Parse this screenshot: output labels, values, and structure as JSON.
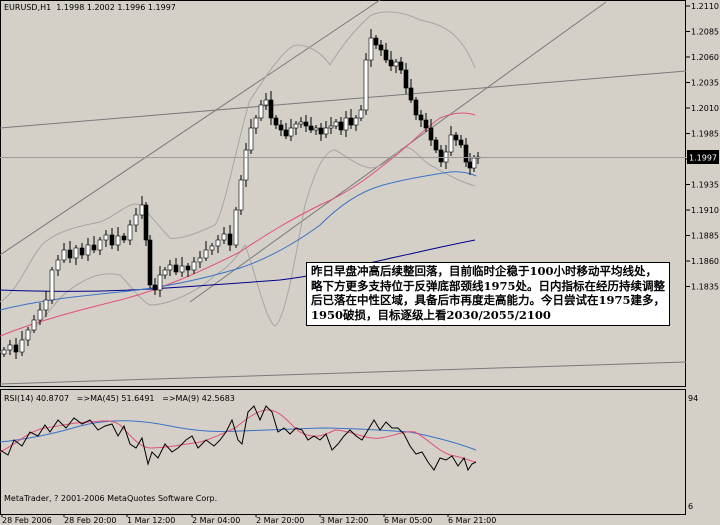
{
  "chart": {
    "symbol_header": "EURUSD,H1  1.1998 1.2002 1.1996 1.1997",
    "last_price": "1.1997",
    "price_ticks": [
      "1.2110",
      "1.2085",
      "1.2060",
      "1.2035",
      "1.2010",
      "1.1985",
      "1.1960",
      "1.1935",
      "1.1910",
      "1.1885",
      "1.1860",
      "1.1835"
    ],
    "time_ticks": [
      "28 Feb 2006",
      "28 Feb 20:00",
      "1 Mar 12:00",
      "2 Mar 04:00",
      "2 Mar 20:00",
      "3 Mar 12:00",
      "6 Mar 05:00",
      "6 Mar 21:00"
    ],
    "colors": {
      "bull": "#ffffff",
      "bear": "#000000",
      "ma_red": "#e0507a",
      "ma_blue": "#3a72c8",
      "ma_navy": "#00008b",
      "bands": "#a9a9a9"
    }
  },
  "comment": {
    "text": "昨日早盘冲高后续整回落，目前临时企稳于100小时移动平均线处，略下方更多支持位于反弹底部颈线1975处。日内指标在经历持续调整后已落在中性区域，具备后市再度走高能力。今日尝试在1975建多，1950破损，目标逐级上看2030/2055/2100"
  },
  "rsi": {
    "header": "RSI(14) 40.8707   =>MA(45) 51.6491   =>MA(9) 42.5683",
    "ticks": [
      "94",
      "6"
    ]
  },
  "footer": {
    "copyright": "MetaTrader, ? 2001-2006 MetaQuotes Software Corp."
  }
}
